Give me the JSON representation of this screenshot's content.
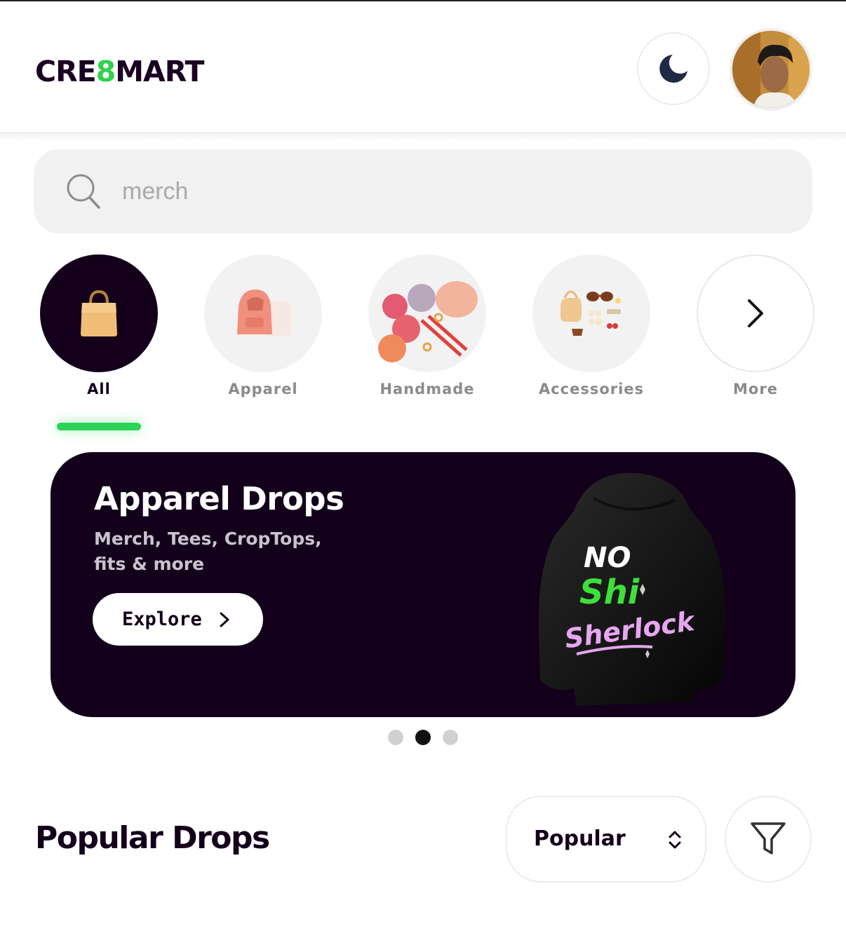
{
  "header": {
    "logo_part1": "CRE",
    "logo_part2": "8",
    "logo_part3": "MART",
    "theme_icon": "moon-icon",
    "avatar_alt": "User avatar"
  },
  "search": {
    "placeholder": "merch",
    "value": ""
  },
  "categories": [
    {
      "label": "All",
      "icon": "shopping-bag-icon",
      "active": true
    },
    {
      "label": "Apparel",
      "icon": "hoodie-icon",
      "active": false
    },
    {
      "label": "Handmade",
      "icon": "yarn-icon",
      "active": false
    },
    {
      "label": "Accessories",
      "icon": "accessories-icon",
      "active": false
    },
    {
      "label": "More",
      "icon": "chevron-right-icon",
      "active": false
    }
  ],
  "banner": {
    "title": "Apparel Drops",
    "subtitle": "Merch, Tees, CropTops, fits & more",
    "button_label": "Explore",
    "hoodie_print": [
      "NO",
      "Shi",
      "Sherlock"
    ]
  },
  "carousel": {
    "count": 3,
    "active_index": 1
  },
  "popular": {
    "title": "Popular Drops",
    "sort_value": "Popular",
    "filter_icon": "filter-icon"
  },
  "colors": {
    "brand_dark": "#14001a",
    "accent_green": "#2ad356",
    "hoodie_pink": "#e7a6f0"
  }
}
